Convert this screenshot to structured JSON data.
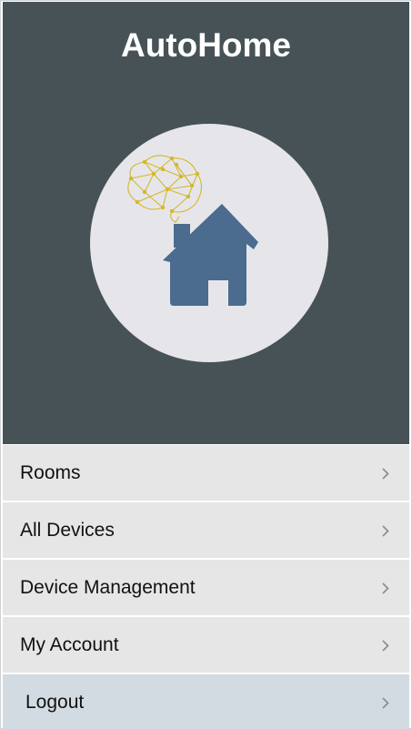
{
  "app": {
    "title": "AutoHome"
  },
  "colors": {
    "header_bg": "#465256",
    "circle_bg": "#e6e6ea",
    "house": "#4b6b8f",
    "brain": "#d4b72a",
    "menu_bg": "#e6e6e6",
    "logout_bg": "#d2dbe1"
  },
  "logo": {
    "icon": "smart-home-brain-icon"
  },
  "menu": {
    "items": [
      {
        "label": "Rooms",
        "icon": "chevron-right-icon"
      },
      {
        "label": "All Devices",
        "icon": "chevron-right-icon"
      },
      {
        "label": "Device Management",
        "icon": "chevron-right-icon"
      },
      {
        "label": "My Account",
        "icon": "chevron-right-icon"
      },
      {
        "label": "Logout",
        "icon": "chevron-right-icon"
      }
    ]
  }
}
